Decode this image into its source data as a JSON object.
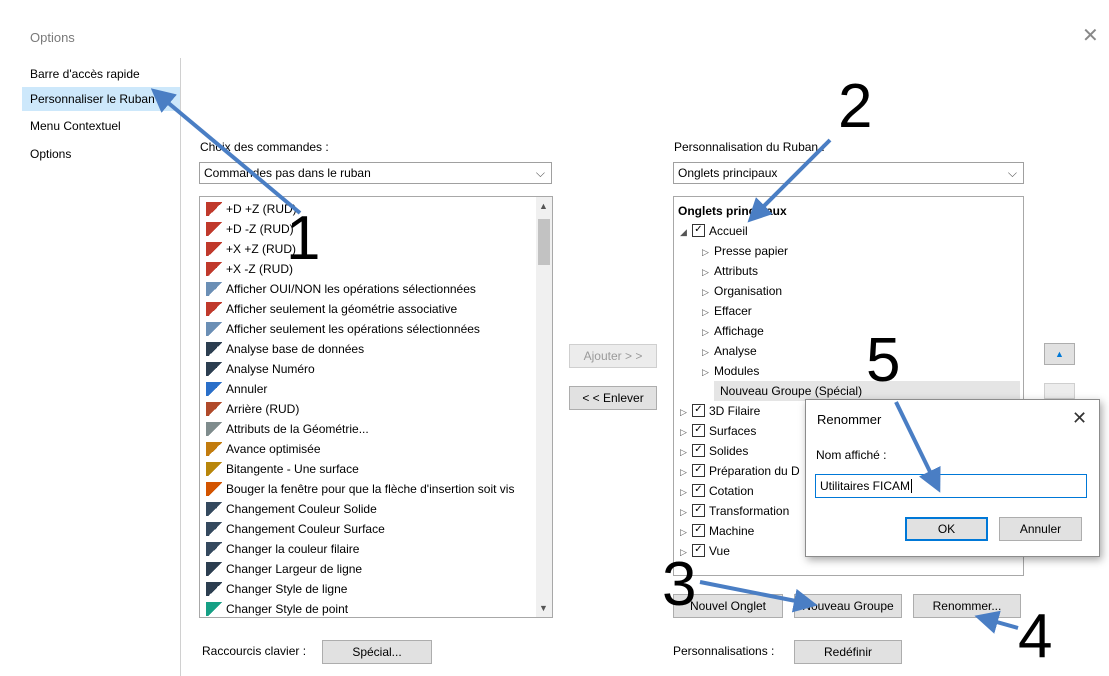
{
  "window": {
    "title": "Options"
  },
  "nav": {
    "items": [
      "Barre d'accès rapide",
      "Personnaliser le Ruban",
      "Menu Contextuel",
      "Options"
    ]
  },
  "left": {
    "label": "Choix des commandes :",
    "combo": "Commandes pas dans le ruban",
    "items": [
      "+D +Z (RUD)",
      "+D -Z (RUD)",
      "+X +Z (RUD)",
      "+X -Z (RUD)",
      "Afficher OUI/NON les opérations sélectionnées",
      "Afficher seulement la géométrie associative",
      "Afficher seulement les opérations sélectionnées",
      "Analyse base de données",
      "Analyse Numéro",
      "Annuler",
      "Arrière (RUD)",
      "Attributs de la Géométrie...",
      "Avance optimisée",
      "Bitangente - Une surface",
      "Bouger la fenêtre pour que la flèche d'insertion soit vis",
      "Changement Couleur Solide",
      "Changement Couleur Surface",
      "Changer la couleur filaire",
      "Changer Largeur de ligne",
      "Changer Style de ligne",
      "Changer Style de point"
    ]
  },
  "middle": {
    "add": "Ajouter > >",
    "remove": "< < Enlever"
  },
  "right": {
    "label": "Personnalisation du Ruban :",
    "combo": "Onglets principaux",
    "header": "Onglets principaux",
    "accueil": "Accueil",
    "subitems": [
      "Presse papier",
      "Attributs",
      "Organisation",
      "Effacer",
      "Affichage",
      "Analyse",
      "Modules"
    ],
    "new_group": "Nouveau Groupe (Spécial)",
    "tabs": [
      "3D Filaire",
      "Surfaces",
      "Solides",
      "Préparation du D",
      "Cotation",
      "Transformation",
      "Machine",
      "Vue"
    ]
  },
  "buttons": {
    "new_tab": "Nouvel Onglet",
    "new_group": "Nouveau Groupe",
    "rename": "Renommer...",
    "special": "Spécial...",
    "reset": "Redéfinir"
  },
  "bottom": {
    "shortcuts": "Raccourcis clavier :",
    "customizations": "Personnalisations :"
  },
  "dialog": {
    "title": "Renommer",
    "field_label": "Nom affiché :",
    "value": "Utilitaires FICAM",
    "ok": "OK",
    "cancel": "Annuler"
  },
  "annotations": [
    "1",
    "2",
    "3",
    "4",
    "5"
  ],
  "colors": {
    "arrow": "#4a7ec4",
    "selection": "#cde8fb",
    "accent": "#0078d7"
  }
}
